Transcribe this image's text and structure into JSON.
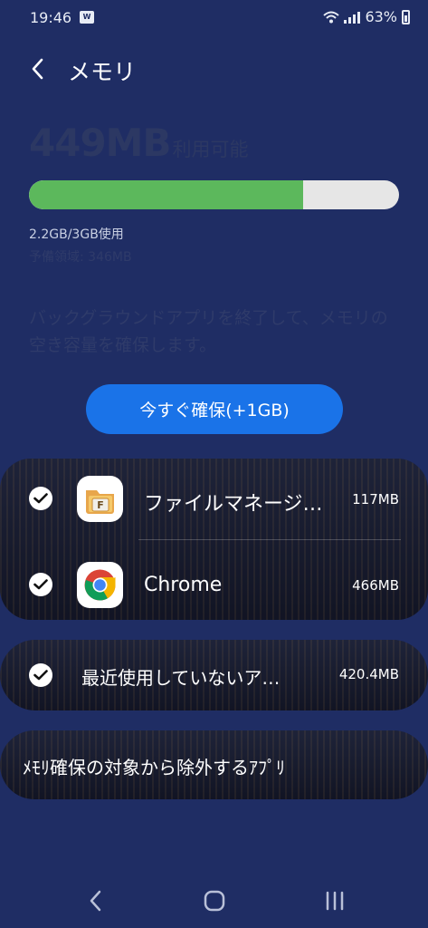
{
  "status_bar": {
    "time": "19:46",
    "notification_icon": "app-notification-icon",
    "battery": "63%"
  },
  "header": {
    "title": "メモリ",
    "back_icon": "back-arrow-icon"
  },
  "memory": {
    "available_value": "449MB",
    "available_label": "利用可能",
    "used_fraction": 0.74,
    "used_text": "2.2GB/3GB使用",
    "reserved_text": "予備領域: 346MB",
    "description": "バックグラウンドアプリを終了して、メモリの空き容量を確保します。",
    "free_button_label": "今すぐ確保(+1GB)"
  },
  "apps": [
    {
      "name": "ファイルマネージ…",
      "size": "117MB",
      "checked": true,
      "icon": "file-manager-icon"
    },
    {
      "name": "Chrome",
      "size": "466MB",
      "checked": true,
      "icon": "chrome-icon"
    }
  ],
  "recent_unused": {
    "label": "最近使用していないア…",
    "size": "420.4MB",
    "checked": true
  },
  "exclude": {
    "label": "ﾒﾓﾘ確保の対象から除外するｱﾌﾟﾘ"
  },
  "colors": {
    "background": "#1f2d64",
    "bar_used": "#5cb85c",
    "bar_free": "#e6e6e6",
    "button": "#1a73e8"
  }
}
